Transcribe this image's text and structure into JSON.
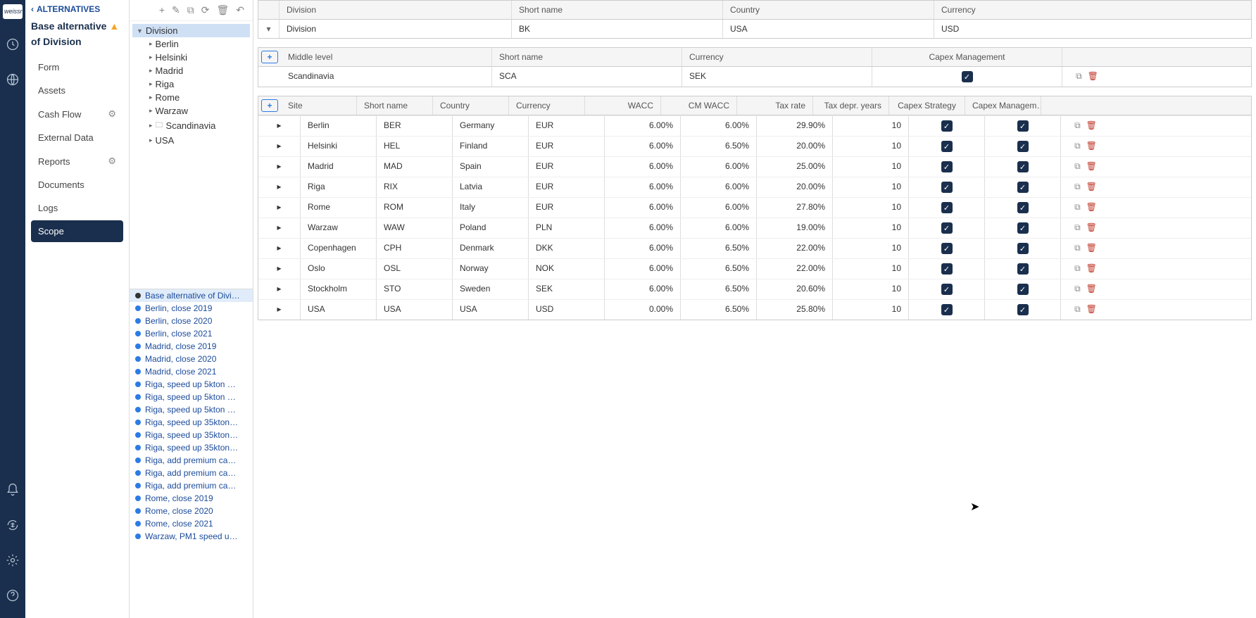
{
  "rail": {
    "logo": "weissr"
  },
  "sidebar": {
    "back": "ALTERNATIVES",
    "title1": "Base alternative",
    "title2": "of Division",
    "nav": [
      {
        "label": "Form",
        "gear": false
      },
      {
        "label": "Assets",
        "gear": false
      },
      {
        "label": "Cash Flow",
        "gear": true
      },
      {
        "label": "External Data",
        "gear": false
      },
      {
        "label": "Reports",
        "gear": true
      },
      {
        "label": "Documents",
        "gear": false
      },
      {
        "label": "Logs",
        "gear": false
      },
      {
        "label": "Scope",
        "gear": false
      }
    ],
    "selected": "Scope"
  },
  "tree": {
    "root": "Division",
    "children": [
      {
        "label": "Berlin",
        "folder": false
      },
      {
        "label": "Helsinki",
        "folder": false
      },
      {
        "label": "Madrid",
        "folder": false
      },
      {
        "label": "Riga",
        "folder": false
      },
      {
        "label": "Rome",
        "folder": false
      },
      {
        "label": "Warzaw",
        "folder": false
      },
      {
        "label": "Scandinavia",
        "folder": true
      },
      {
        "label": "USA",
        "folder": false
      }
    ]
  },
  "alternatives": [
    {
      "label": "Base alternative of Divi…",
      "dot": "black",
      "sel": true
    },
    {
      "label": "Berlin, close 2019",
      "dot": "blue"
    },
    {
      "label": "Berlin, close 2020",
      "dot": "blue"
    },
    {
      "label": "Berlin, close 2021",
      "dot": "blue"
    },
    {
      "label": "Madrid, close 2019",
      "dot": "blue"
    },
    {
      "label": "Madrid, close 2020",
      "dot": "blue"
    },
    {
      "label": "Madrid, close 2021",
      "dot": "blue"
    },
    {
      "label": "Riga, speed up 5kton …",
      "dot": "blue"
    },
    {
      "label": "Riga, speed up 5kton …",
      "dot": "blue"
    },
    {
      "label": "Riga, speed up 5kton …",
      "dot": "blue"
    },
    {
      "label": "Riga, speed up 35kton…",
      "dot": "blue"
    },
    {
      "label": "Riga, speed up 35kton…",
      "dot": "blue"
    },
    {
      "label": "Riga, speed up 35kton…",
      "dot": "blue"
    },
    {
      "label": "Riga, add premium ca…",
      "dot": "blue"
    },
    {
      "label": "Riga, add premium ca…",
      "dot": "blue"
    },
    {
      "label": "Riga, add premium ca…",
      "dot": "blue"
    },
    {
      "label": "Rome, close 2019",
      "dot": "blue"
    },
    {
      "label": "Rome, close 2020",
      "dot": "blue"
    },
    {
      "label": "Rome, close 2021",
      "dot": "blue"
    },
    {
      "label": "Warzaw, PM1 speed u…",
      "dot": "blue"
    }
  ],
  "division_table": {
    "headers": [
      "Division",
      "Short name",
      "Country",
      "Currency"
    ],
    "row": {
      "division": "Division",
      "short": "BK",
      "country": "USA",
      "currency": "USD"
    }
  },
  "middle_table": {
    "headers": [
      "Middle level",
      "Short name",
      "Currency",
      "Capex Management"
    ],
    "row": {
      "name": "Scandinavia",
      "short": "SCA",
      "currency": "SEK",
      "capex": true
    }
  },
  "site_table": {
    "headers": [
      "Site",
      "Short name",
      "Country",
      "Currency",
      "WACC",
      "CM WACC",
      "Tax rate",
      "Tax depr. years",
      "Capex Strategy",
      "Capex Managem…"
    ],
    "rows": [
      {
        "site": "Berlin",
        "short": "BER",
        "country": "Germany",
        "currency": "EUR",
        "wacc": "6.00%",
        "cmwacc": "6.00%",
        "tax": "29.90%",
        "years": "10",
        "cs": true,
        "cm": true
      },
      {
        "site": "Helsinki",
        "short": "HEL",
        "country": "Finland",
        "currency": "EUR",
        "wacc": "6.00%",
        "cmwacc": "6.50%",
        "tax": "20.00%",
        "years": "10",
        "cs": true,
        "cm": true
      },
      {
        "site": "Madrid",
        "short": "MAD",
        "country": "Spain",
        "currency": "EUR",
        "wacc": "6.00%",
        "cmwacc": "6.00%",
        "tax": "25.00%",
        "years": "10",
        "cs": true,
        "cm": true
      },
      {
        "site": "Riga",
        "short": "RIX",
        "country": "Latvia",
        "currency": "EUR",
        "wacc": "6.00%",
        "cmwacc": "6.00%",
        "tax": "20.00%",
        "years": "10",
        "cs": true,
        "cm": true
      },
      {
        "site": "Rome",
        "short": "ROM",
        "country": "Italy",
        "currency": "EUR",
        "wacc": "6.00%",
        "cmwacc": "6.00%",
        "tax": "27.80%",
        "years": "10",
        "cs": true,
        "cm": true
      },
      {
        "site": "Warzaw",
        "short": "WAW",
        "country": "Poland",
        "currency": "PLN",
        "wacc": "6.00%",
        "cmwacc": "6.00%",
        "tax": "19.00%",
        "years": "10",
        "cs": true,
        "cm": true
      },
      {
        "site": "Copenhagen",
        "short": "CPH",
        "country": "Denmark",
        "currency": "DKK",
        "wacc": "6.00%",
        "cmwacc": "6.50%",
        "tax": "22.00%",
        "years": "10",
        "cs": true,
        "cm": true
      },
      {
        "site": "Oslo",
        "short": "OSL",
        "country": "Norway",
        "currency": "NOK",
        "wacc": "6.00%",
        "cmwacc": "6.50%",
        "tax": "22.00%",
        "years": "10",
        "cs": true,
        "cm": true
      },
      {
        "site": "Stockholm",
        "short": "STO",
        "country": "Sweden",
        "currency": "SEK",
        "wacc": "6.00%",
        "cmwacc": "6.50%",
        "tax": "20.60%",
        "years": "10",
        "cs": true,
        "cm": true
      },
      {
        "site": "USA",
        "short": "USA",
        "country": "USA",
        "currency": "USD",
        "wacc": "0.00%",
        "cmwacc": "6.50%",
        "tax": "25.80%",
        "years": "10",
        "cs": true,
        "cm": true
      }
    ]
  }
}
